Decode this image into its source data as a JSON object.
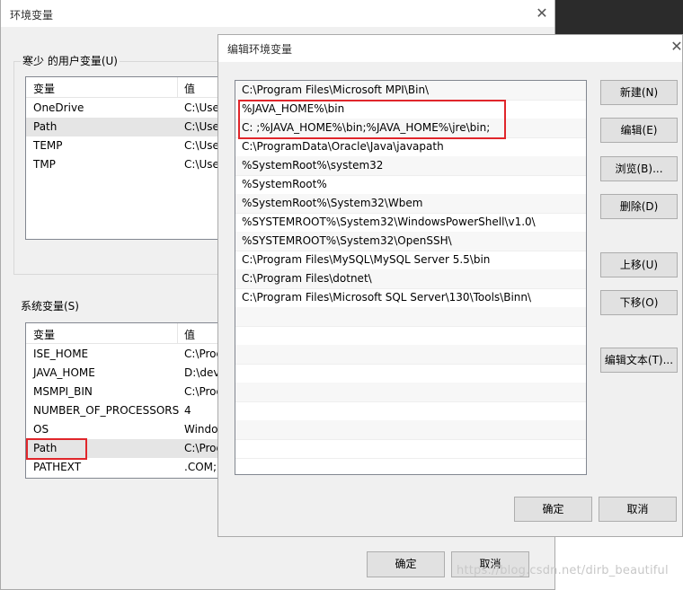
{
  "bg_window": {
    "title": "环境变量",
    "close_glyph": "✕",
    "user_section_label": "寒少 的用户变量(U)",
    "system_section_label": "系统变量(S)",
    "col_var": "变量",
    "col_value": "值",
    "user_vars": [
      {
        "name": "OneDrive",
        "value": "C:\\Use"
      },
      {
        "name": "Path",
        "value": "C:\\Use"
      },
      {
        "name": "TEMP",
        "value": "C:\\Use"
      },
      {
        "name": "TMP",
        "value": "C:\\Use"
      }
    ],
    "system_vars": [
      {
        "name": "ISE_HOME",
        "value": "C:\\Prog"
      },
      {
        "name": "JAVA_HOME",
        "value": "D:\\dev"
      },
      {
        "name": "MSMPI_BIN",
        "value": "C:\\Prog"
      },
      {
        "name": "NUMBER_OF_PROCESSORS",
        "value": "4"
      },
      {
        "name": "OS",
        "value": "Windo"
      },
      {
        "name": "Path",
        "value": "C:\\Prog"
      },
      {
        "name": "PATHEXT",
        "value": ".COM;."
      }
    ],
    "ok_label": "确定",
    "cancel_label": "取消"
  },
  "edit_dialog": {
    "title": "编辑环境变量",
    "close_glyph": "✕",
    "paths": [
      "C:\\Program Files\\Microsoft MPI\\Bin\\",
      "%JAVA_HOME%\\bin",
      "C:  ;%JAVA_HOME%\\bin;%JAVA_HOME%\\jre\\bin;",
      "C:\\ProgramData\\Oracle\\Java\\javapath",
      "%SystemRoot%\\system32",
      "%SystemRoot%",
      "%SystemRoot%\\System32\\Wbem",
      "%SYSTEMROOT%\\System32\\WindowsPowerShell\\v1.0\\",
      "%SYSTEMROOT%\\System32\\OpenSSH\\",
      "C:\\Program Files\\MySQL\\MySQL Server 5.5\\bin",
      "C:\\Program Files\\dotnet\\",
      "C:\\Program Files\\Microsoft SQL Server\\130\\Tools\\Binn\\"
    ],
    "buttons": {
      "new": "新建(N)",
      "edit": "编辑(E)",
      "browse": "浏览(B)...",
      "delete": "删除(D)",
      "move_up": "上移(U)",
      "move_down": "下移(O)",
      "edit_text": "编辑文本(T)..."
    },
    "ok_label": "确定",
    "cancel_label": "取消"
  },
  "highlight_color": "#e0262b",
  "watermark": "https://blog.csdn.net/dirb_beautiful"
}
